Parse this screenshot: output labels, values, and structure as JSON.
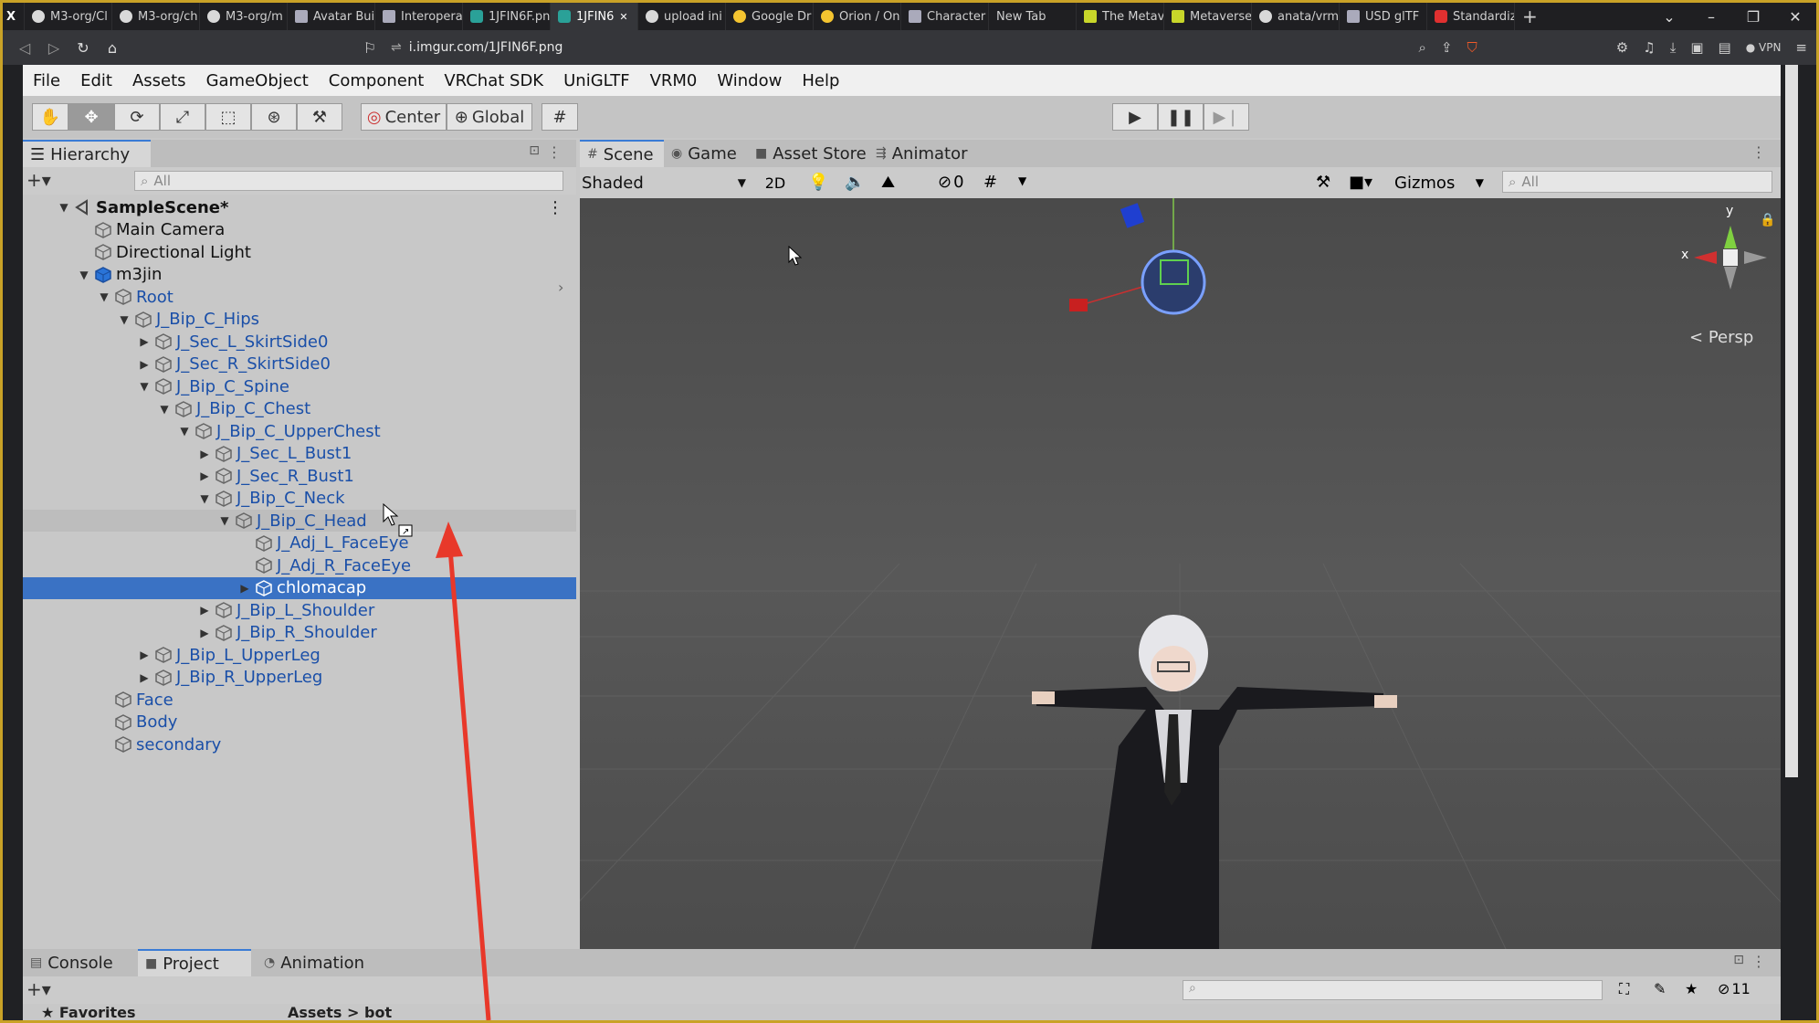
{
  "browser": {
    "tabs": [
      {
        "label": "M3-org/Cl",
        "fav": "github-icon"
      },
      {
        "label": "M3-org/ch",
        "fav": "github-icon"
      },
      {
        "label": "M3-org/m",
        "fav": "github-icon"
      },
      {
        "label": "Avatar Buil",
        "fav": "page-icon"
      },
      {
        "label": "Interopera",
        "fav": "page-icon"
      },
      {
        "label": "1JFIN6F.pn",
        "fav": "imgur-icon"
      },
      {
        "label": "1JFIN6",
        "fav": "imgur-icon",
        "active": true
      },
      {
        "label": "upload ini",
        "fav": "github-icon"
      },
      {
        "label": "Google Dr",
        "fav": "drive-icon"
      },
      {
        "label": "Orion / On",
        "fav": "orion-icon"
      },
      {
        "label": "Character",
        "fav": "page-icon"
      },
      {
        "label": "New Tab",
        "fav": "none"
      },
      {
        "label": "The Metav",
        "fav": "v-icon"
      },
      {
        "label": "Metaverse",
        "fav": "v-icon"
      },
      {
        "label": "anata/vrm",
        "fav": "github-icon"
      },
      {
        "label": "USD glTF",
        "fav": "page-icon"
      },
      {
        "label": "Standardiz",
        "fav": "youtube-icon"
      }
    ],
    "url": "i.imgur.com/1JFIN6F.png",
    "vpn_label": "VPN"
  },
  "unity": {
    "menu": [
      "File",
      "Edit",
      "Assets",
      "GameObject",
      "Component",
      "VRChat SDK",
      "UniGLTF",
      "VRM0",
      "Window",
      "Help"
    ],
    "pivot_label": "Center",
    "space_label": "Global",
    "hierarchy": {
      "title": "Hierarchy",
      "search_placeholder": "All",
      "rows": [
        {
          "label": "SampleScene*",
          "depth": 0,
          "expanded": true,
          "scene": true
        },
        {
          "label": "Main Camera",
          "depth": 1
        },
        {
          "label": "Directional Light",
          "depth": 1
        },
        {
          "label": "m3jin",
          "depth": 1,
          "expanded": true,
          "prefab": true
        },
        {
          "label": "Root",
          "depth": 2,
          "expanded": true,
          "blue": true
        },
        {
          "label": "J_Bip_C_Hips",
          "depth": 3,
          "expanded": true,
          "blue": true
        },
        {
          "label": "J_Sec_L_SkirtSide0",
          "depth": 4,
          "collapsed": true,
          "blue": true
        },
        {
          "label": "J_Sec_R_SkirtSide0",
          "depth": 4,
          "collapsed": true,
          "blue": true
        },
        {
          "label": "J_Bip_C_Spine",
          "depth": 4,
          "expanded": true,
          "blue": true
        },
        {
          "label": "J_Bip_C_Chest",
          "depth": 5,
          "expanded": true,
          "blue": true
        },
        {
          "label": "J_Bip_C_UpperChest",
          "depth": 6,
          "expanded": true,
          "blue": true
        },
        {
          "label": "J_Sec_L_Bust1",
          "depth": 7,
          "collapsed": true,
          "blue": true
        },
        {
          "label": "J_Sec_R_Bust1",
          "depth": 7,
          "collapsed": true,
          "blue": true
        },
        {
          "label": "J_Bip_C_Neck",
          "depth": 7,
          "expanded": true,
          "blue": true
        },
        {
          "label": "J_Bip_C_Head",
          "depth": 8,
          "expanded": true,
          "blue": true,
          "hover": true
        },
        {
          "label": "J_Adj_L_FaceEye",
          "depth": 9,
          "blue": true
        },
        {
          "label": "J_Adj_R_FaceEye",
          "depth": 9,
          "blue": true
        },
        {
          "label": "chlomacap",
          "depth": 9,
          "collapsed": true,
          "selected": true
        },
        {
          "label": "J_Bip_L_Shoulder",
          "depth": 7,
          "collapsed": true,
          "blue": true
        },
        {
          "label": "J_Bip_R_Shoulder",
          "depth": 7,
          "collapsed": true,
          "blue": true
        },
        {
          "label": "J_Bip_L_UpperLeg",
          "depth": 4,
          "collapsed": true,
          "blue": true
        },
        {
          "label": "J_Bip_R_UpperLeg",
          "depth": 4,
          "collapsed": true,
          "blue": true
        },
        {
          "label": "Face",
          "depth": 2,
          "blue": true
        },
        {
          "label": "Body",
          "depth": 2,
          "blue": true
        },
        {
          "label": "secondary",
          "depth": 2,
          "blue": true
        }
      ]
    },
    "scene_tabs": [
      {
        "label": "Scene",
        "active": true
      },
      {
        "label": "Game"
      },
      {
        "label": "Asset Store"
      },
      {
        "label": "Animator"
      }
    ],
    "scene_toolbar": {
      "shading": "Shaded",
      "mode_2d": "2D",
      "hidden_count": "0",
      "gizmos": "Gizmos",
      "search_placeholder": "All"
    },
    "gizmo": {
      "x_label": "x",
      "y_label": "y",
      "projection": "Persp"
    },
    "bottom_tabs": [
      {
        "label": "Console"
      },
      {
        "label": "Project",
        "active": true
      },
      {
        "label": "Animation"
      }
    ],
    "bottom_count": "11",
    "favorites_label": "Favorites",
    "assets_label": "Assets > bot"
  },
  "colors": {
    "selection": "#3a72c4",
    "annotation_arrow": "#e8382a",
    "border": "#c9a227"
  }
}
